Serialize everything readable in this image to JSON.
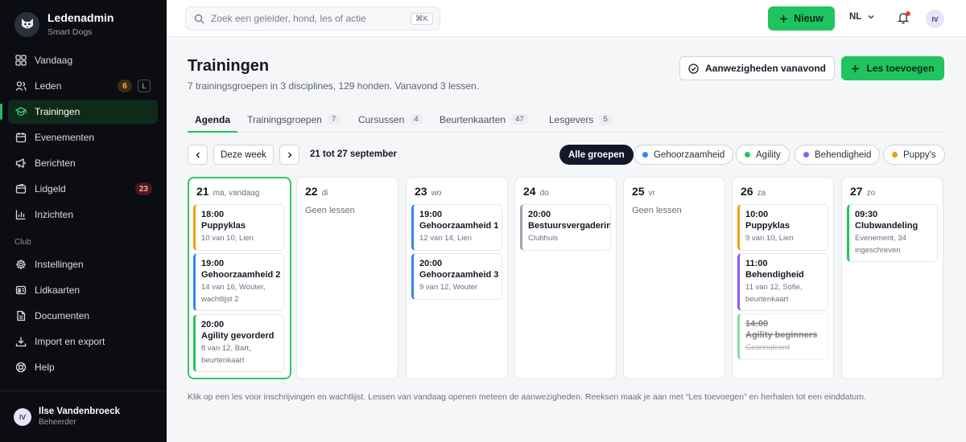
{
  "brand": {
    "title": "Ledenadmin",
    "subtitle": "Smart Dogs"
  },
  "nav": {
    "items": [
      {
        "label": "Vandaag",
        "icon": "grid-icon"
      },
      {
        "label": "Leden",
        "icon": "users-icon",
        "badge": "6",
        "shortcut": "L"
      },
      {
        "label": "Trainingen",
        "icon": "graduation-cap-icon",
        "active": true
      },
      {
        "label": "Evenementen",
        "icon": "calendar-icon"
      },
      {
        "label": "Berichten",
        "icon": "megaphone-icon"
      },
      {
        "label": "Lidgeld",
        "icon": "wallet-icon",
        "badge": "23"
      },
      {
        "label": "Inzichten",
        "icon": "bar-chart-icon"
      }
    ],
    "section_label": "Club",
    "club_items": [
      {
        "label": "Instellingen",
        "icon": "gear-icon"
      },
      {
        "label": "Lidkaarten",
        "icon": "id-card-icon"
      },
      {
        "label": "Documenten",
        "icon": "document-icon"
      },
      {
        "label": "Import en export",
        "icon": "download-icon"
      },
      {
        "label": "Help",
        "icon": "help-icon"
      }
    ]
  },
  "user": {
    "initials": "IV",
    "name": "Ilse Vandenbroeck",
    "role": "Beheerder"
  },
  "topbar": {
    "search_placeholder": "Zoek een geleider, hond, les of actie",
    "search_shortcut": "⌘K",
    "new_label": "Nieuw",
    "language": "NL",
    "avatar_initials": "IV"
  },
  "page": {
    "title": "Trainingen",
    "subtitle": "7 trainingsgroepen in 3 disciplines, 129 honden. Vanavond 3 lessen.",
    "attendance_label": "Aanwezigheden vanavond",
    "add_lesson_label": "Les toevoegen"
  },
  "tabs": [
    {
      "label": "Agenda",
      "active": true
    },
    {
      "label": "Trainingsgroepen",
      "count": "7"
    },
    {
      "label": "Cursussen",
      "count": "4"
    },
    {
      "label": "Beurtenkaarten",
      "count": "47"
    },
    {
      "label": "Lesgevers",
      "count": "5"
    }
  ],
  "week": {
    "this_week_label": "Deze week",
    "range": "21 tot 27 september"
  },
  "filters": [
    {
      "label": "Alle groepen",
      "active": true
    },
    {
      "label": "Gehoorzaamheid",
      "color": "#3b82f6"
    },
    {
      "label": "Agility",
      "color": "#22c55e"
    },
    {
      "label": "Behendigheid",
      "color": "#8b5cf6"
    },
    {
      "label": "Puppy's",
      "color": "#f59e0b"
    }
  ],
  "days": [
    {
      "num": "21",
      "name": "ma, vandaag",
      "today": true,
      "lessons": [
        {
          "time": "18:00",
          "name": "Puppyklas",
          "meta": "10 van 10, Lien",
          "color": "#f59e0b"
        },
        {
          "time": "19:00",
          "name": "Gehoorzaamheid 2",
          "meta": "14 van 16, Wouter, wachtlijst 2",
          "color": "#3b82f6"
        },
        {
          "time": "20:00",
          "name": "Agility gevorderd",
          "meta": "8 van 12, Bart, beurtenkaart",
          "color": "#22c55e"
        }
      ]
    },
    {
      "num": "22",
      "name": "di",
      "empty": "Geen lessen",
      "lessons": []
    },
    {
      "num": "23",
      "name": "wo",
      "lessons": [
        {
          "time": "19:00",
          "name": "Gehoorzaamheid 1",
          "meta": "12 van 14, Lien",
          "color": "#3b82f6"
        },
        {
          "time": "20:00",
          "name": "Gehoorzaamheid 3",
          "meta": "9 van 12, Wouter",
          "color": "#3b82f6"
        }
      ]
    },
    {
      "num": "24",
      "name": "do",
      "lessons": [
        {
          "time": "20:00",
          "name": "Bestuursvergadering",
          "meta": "Clubhuis",
          "color": "#9ca3af"
        }
      ]
    },
    {
      "num": "25",
      "name": "vr",
      "empty": "Geen lessen",
      "lessons": []
    },
    {
      "num": "26",
      "name": "za",
      "lessons": [
        {
          "time": "10:00",
          "name": "Puppyklas",
          "meta": "9 van 10, Lien",
          "color": "#f59e0b"
        },
        {
          "time": "11:00",
          "name": "Behendigheid",
          "meta": "11 van 12, Sofie, beurtenkaart",
          "color": "#8b5cf6"
        },
        {
          "time": "14:00",
          "name": "Agility beginners",
          "meta": "Geannuleerd",
          "color": "#22c55e",
          "cancelled": true
        }
      ]
    },
    {
      "num": "27",
      "name": "zo",
      "lessons": [
        {
          "time": "09:30",
          "name": "Clubwandeling",
          "meta": "Evenement, 34 ingeschreven",
          "color": "#22c55e"
        }
      ]
    }
  ],
  "footnote": "Klik op een les voor inschrijvingen en wachtlijst. Lessen van vandaag openen meteen de aanwezigheden. Reeksen maak je aan met “Les toevoegen” en herhalen tot een einddatum."
}
